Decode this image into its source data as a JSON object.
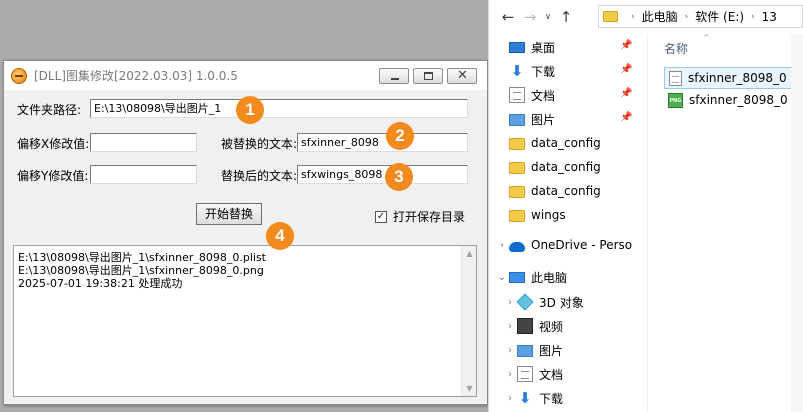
{
  "tool_window": {
    "title": "[DLL]图集修改[2022.03.03] 1.0.0.5",
    "folder_path_label": "文件夹路径:",
    "folder_path_value": "E:\\13\\08098\\导出图片_1",
    "offset_x_label": "偏移X修改值:",
    "offset_x_value": "",
    "offset_y_label": "偏移Y修改值:",
    "offset_y_value": "",
    "replaced_text_label": "被替换的文本:",
    "replaced_text_value": "sfxinner_8098",
    "replacement_text_label": "替换后的文本:",
    "replacement_text_value": "sfxwings_8098",
    "start_button_label": "开始替换",
    "open_dir_checkbox_label": "打开保存目录",
    "open_dir_checked": true,
    "log_lines": [
      "E:\\13\\08098\\导出图片_1\\sfxinner_8098_0.plist",
      "E:\\13\\08098\\导出图片_1\\sfxinner_8098_0.png",
      "2025-07-01 19:38:21 处理成功"
    ],
    "badges": [
      "1",
      "2",
      "3",
      "4"
    ],
    "accent_color": "#f28a1e"
  },
  "explorer": {
    "breadcrumb": [
      "此电脑",
      "软件 (E:)",
      "13"
    ],
    "nav_items": [
      {
        "label": "桌面",
        "icon": "desktop-icon",
        "pinned": true
      },
      {
        "label": "下载",
        "icon": "download-icon",
        "pinned": true
      },
      {
        "label": "文档",
        "icon": "document-icon",
        "pinned": true
      },
      {
        "label": "图片",
        "icon": "picture-icon",
        "pinned": true
      },
      {
        "label": "data_config",
        "icon": "folder-icon",
        "pinned": false
      },
      {
        "label": "data_config",
        "icon": "folder-icon",
        "pinned": false
      },
      {
        "label": "data_config",
        "icon": "folder-icon",
        "pinned": false
      },
      {
        "label": "wings",
        "icon": "folder-icon",
        "pinned": false
      },
      {
        "label": "OneDrive - Perso",
        "icon": "onedrive-icon",
        "pinned": false
      },
      {
        "label": "此电脑",
        "icon": "computer-icon",
        "pinned": false
      },
      {
        "label": "3D 对象",
        "icon": "3d-objects-icon",
        "pinned": false
      },
      {
        "label": "视频",
        "icon": "video-icon",
        "pinned": false
      },
      {
        "label": "图片",
        "icon": "picture-icon",
        "pinned": false
      },
      {
        "label": "文档",
        "icon": "document-icon",
        "pinned": false
      },
      {
        "label": "下载",
        "icon": "download-icon",
        "pinned": false
      }
    ],
    "column_header": "名称",
    "files": [
      {
        "name": "sfxinner_8098_0",
        "icon": "file-icon"
      },
      {
        "name": "sfxinner_8098_0",
        "icon": "png-file-icon"
      }
    ],
    "png_icon_text": "PNG"
  }
}
